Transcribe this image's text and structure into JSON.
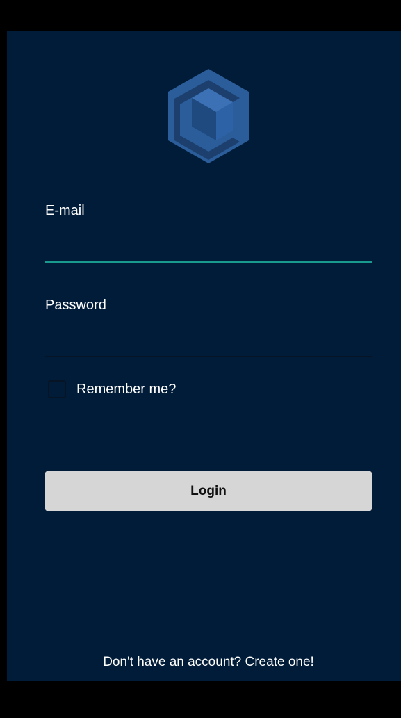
{
  "colors": {
    "background": "#011c38",
    "accent": "#1a9a8f",
    "button": "#d6d6d6",
    "logo_primary": "#2a5d9a",
    "logo_dark": "#1c3f6e"
  },
  "logo": {
    "icon": "cube-logo-icon"
  },
  "form": {
    "email_label": "E-mail",
    "email_value": "",
    "password_label": "Password",
    "password_value": "",
    "remember_label": "Remember me?",
    "remember_checked": false,
    "login_label": "Login"
  },
  "footer": {
    "signup_link": "Don't have an account? Create one!"
  }
}
